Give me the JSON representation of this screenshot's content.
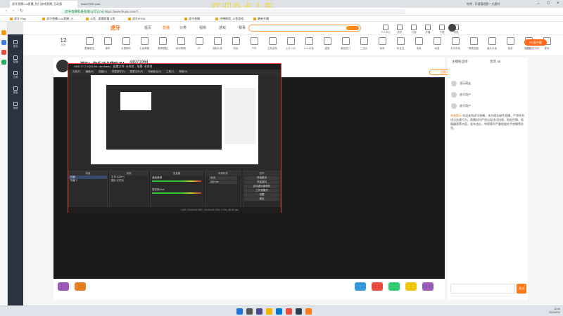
{
  "browser": {
    "tabs": [
      {
        "label": "虎牙直播-Lol直播_热门游戏直播_互动直",
        "active": true
      },
      {
        "label": "www.2345.com",
        "active": false
      },
      {
        "label": "官网",
        "active": false
      },
      {
        "label": "分享 | 斗鱼直播",
        "active": false
      }
    ],
    "right_tab": "哈啰 - 开速管理第一大超时",
    "url_prefix": "安全",
    "url_site": "虎牙直播科技有限公司 [CN]",
    "url": "https://www.huya.com/?...",
    "bookmarks": [
      "虎牙 Play",
      "虎牙直播-LoL直播_火...",
      "斗鱼 - 直播就看斗鱼",
      "虎牙HTML",
      "虎牙直播",
      "开播教程_斗鱼游戏...",
      "最新开播"
    ],
    "watermark": "欢迎办卡上车"
  },
  "site": {
    "logo": "虎牙",
    "nav": [
      "首页",
      "直播",
      "分类",
      "视频",
      "游戏",
      "赛事"
    ],
    "nav_active": "直播",
    "topicons": [
      "个人中心",
      "历史",
      "订阅",
      "开播",
      "下载",
      "消息"
    ],
    "date_day": "12",
    "date_sub": "月份",
    "categories": [
      "直播首页",
      "单机",
      "无畏契约",
      "王者荣耀",
      "英雄联盟",
      "和平精英",
      "CF",
      "穿越火线",
      "吃鸡",
      "户外",
      "主机游戏",
      "上分·LOL",
      "LOL手游",
      "星秀",
      "单机热门",
      "二次元",
      "体育",
      "车友社",
      "电竞",
      "动漫",
      "天天吃鸡",
      "搞笑视频",
      "娱乐天地",
      "旅游",
      "综艺",
      "更多"
    ],
    "pc_button": "PC客户端",
    "pc_sub": "看直播更流畅"
  },
  "room": {
    "title": "逆伍：你乐对卡我吗了！",
    "id": "44971964",
    "subscribe": "订阅 11万"
  },
  "obs": {
    "title": "OBS 27.2.3 (64-bit, windows) - 配置文件: 未命名 - 场景: 未命名",
    "menu": [
      "文件(F)",
      "编辑(E)",
      "视图(V)",
      "停靠部件(D)",
      "配置文件(P)",
      "场景集合(S)",
      "工具(T)",
      "帮助(H)"
    ],
    "docks": [
      "场景",
      "来源",
      "混音器",
      "转场特效",
      "控件"
    ],
    "scenes": [
      "场景",
      "场景 2"
    ],
    "sources": [
      "文本 (GDI+)",
      "图片 幻灯片"
    ],
    "mixer": [
      "桌面音频",
      "麦克风/Aux"
    ],
    "transition": "淡出",
    "duration": "300 ms",
    "controls": [
      "开始推流",
      "开始录制",
      "启动虚拟摄像机",
      "工作室模式",
      "设置",
      "退出"
    ],
    "status": "LIVE: 00:00:00    REC: 00:00:00    CPU: 2.9%, 60.00 fps"
  },
  "chat": {
    "tabs": [
      "主播粉丝榜",
      "贵宾 48"
    ],
    "users": [
      "凌乐萌宝",
      "虎牙用户",
      "虎牙用户"
    ],
    "notice_label": "系统提示",
    "notice": "欢迎来到虎牙直播，本台倡导绿色直播，严禁任何违法违规行为。直播间内严禁出现违法违规、低俗色情、吸烟酗酒等内容，若有违反，将视情节严重程度给予禁播等处罚。",
    "send": "发送"
  },
  "taskbar": {
    "time": "12:44",
    "date": "2022/5/22"
  }
}
